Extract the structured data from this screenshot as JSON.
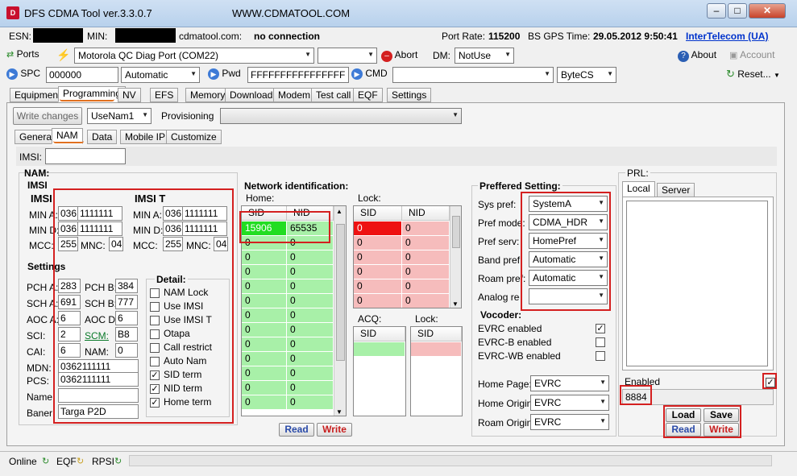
{
  "window": {
    "title": "DFS CDMA Tool ver.3.3.0.7",
    "site": "WWW.CDMATOOL.COM",
    "icon_letter": "D"
  },
  "infobar": {
    "esn_label": "ESN:",
    "min_label": "MIN:",
    "site_label": "cdmatool.com:",
    "connection_status": "no connection",
    "port_rate_label": "Port Rate:",
    "port_rate_value": "115200",
    "bs_gps_label": "BS GPS Time:",
    "bs_gps_value": "29.05.2012 9:50:41",
    "operator_link": "InterTelecom (UA)"
  },
  "toolbar1": {
    "ports_label": "Ports",
    "port_select": "Motorola QC Diag Port (COM22)",
    "abort_label": "Abort",
    "dm_label": "DM:",
    "dm_select": "NotUse",
    "about_label": "About",
    "account_label": "Account"
  },
  "toolbar2": {
    "spc_label": "SPC",
    "spc_value": "000000",
    "spc_mode": "Automatic",
    "pwd_label": "Pwd",
    "pwd_value": "FFFFFFFFFFFFFFFF",
    "cmd_label": "CMD",
    "cmd_value": "",
    "bytecs_select": "ByteCS",
    "reset_label": "Reset..."
  },
  "main_tabs": [
    "Equipment",
    "Programming",
    "NV",
    "EFS",
    "Memory",
    "Download",
    "Modem",
    "Test call",
    "EQF",
    "Settings"
  ],
  "programming": {
    "write_changes": "Write changes",
    "nam_select": "UseNam1",
    "provisioning_label": "Provisioning",
    "provisioning_value": ""
  },
  "sub_tabs": [
    "General",
    "NAM",
    "Data",
    "Mobile IP",
    "Customize"
  ],
  "imsi_label": "IMSI:",
  "imsi_value": "",
  "nam": {
    "section_label": "NAM:",
    "imsi_group_label": "IMSI",
    "imsi": {
      "label": "IMSI",
      "min_a_label": "MIN A:",
      "min_a_1": "036",
      "min_a_2": "1111111",
      "min_d_label": "MIN D:",
      "min_d_1": "036",
      "min_d_2": "1111111",
      "mcc_label": "MCC:",
      "mcc_value": "255",
      "mnc_label": "MNC:",
      "mnc_value": "04"
    },
    "imsi_t": {
      "label": "IMSI T",
      "min_a_label": "MIN A:",
      "min_a_1": "036",
      "min_a_2": "1111111",
      "min_d_label": "MIN D:",
      "min_d_1": "036",
      "min_d_2": "1111111",
      "mcc_label": "MCC:",
      "mcc_value": "255",
      "mnc_label": "MNC:",
      "mnc_value": "04"
    },
    "settings": {
      "label": "Settings",
      "pch_a_label": "PCH A:",
      "pch_a": "283",
      "pch_b_label": "PCH B:",
      "pch_b": "384",
      "sch_a_label": "SCH A:",
      "sch_a": "691",
      "sch_b_label": "SCH B:",
      "sch_b": "777",
      "aoc_a_label": "AOC A:",
      "aoc_a": "6",
      "aoc_d_label": "AOC D:",
      "aoc_d": "6",
      "sci_label": "SCI:",
      "sci": "2",
      "scm_label": "SCM:",
      "scm": "B8",
      "cai_label": "CAI:",
      "cai": "6",
      "nam_label": "NAM:",
      "nam": "0",
      "mdn_label": "MDN:",
      "mdn": "0362111111",
      "pcs_label": "PCS:",
      "pcs": "0362111111",
      "name_label": "Name:",
      "name": "",
      "baner_label": "Baner:",
      "baner": "Targa P2D"
    },
    "detail": {
      "label": "Detail:",
      "items": [
        {
          "label": "NAM Lock",
          "checked": false
        },
        {
          "label": "Use IMSI",
          "checked": false
        },
        {
          "label": "Use IMSI T",
          "checked": false
        },
        {
          "label": "Otapa",
          "checked": false
        },
        {
          "label": "Call restrict",
          "checked": false
        },
        {
          "label": "Auto Nam",
          "checked": false
        },
        {
          "label": "SID term",
          "checked": true
        },
        {
          "label": "NID term",
          "checked": true
        },
        {
          "label": "Home term",
          "checked": true
        }
      ]
    }
  },
  "network": {
    "label": "Network identification:",
    "home_label": "Home:",
    "home_sid_header": "SID",
    "home_nid_header": "NID",
    "home_rows": [
      [
        "15906",
        "65535"
      ],
      [
        "0",
        "0"
      ],
      [
        "0",
        "0"
      ],
      [
        "0",
        "0"
      ],
      [
        "0",
        "0"
      ],
      [
        "0",
        "0"
      ],
      [
        "0",
        "0"
      ],
      [
        "0",
        "0"
      ],
      [
        "0",
        "0"
      ],
      [
        "0",
        "0"
      ],
      [
        "0",
        "0"
      ],
      [
        "0",
        "0"
      ],
      [
        "0",
        "0"
      ]
    ],
    "lock_label": "Lock:",
    "lock_sid_header": "SID",
    "lock_nid_header": "NID",
    "lock_rows": [
      [
        "0",
        "0"
      ],
      [
        "0",
        "0"
      ],
      [
        "0",
        "0"
      ],
      [
        "0",
        "0"
      ],
      [
        "0",
        "0"
      ],
      [
        "0",
        "0"
      ]
    ],
    "acq_label": "ACQ:",
    "acq_header": "SID",
    "lock2_label": "Lock:",
    "lock2_header": "SID",
    "read_label": "Read",
    "write_label": "Write",
    "green_color": "#a8f0a8",
    "pink_color": "#f6bcbc"
  },
  "preferred": {
    "label": "Preffered Setting:",
    "sys_pref_label": "Sys pref:",
    "sys_pref": "SystemA",
    "pref_mode_label": "Pref mode:",
    "pref_mode": "CDMA_HDR",
    "pref_serv_label": "Pref serv:",
    "pref_serv": "HomePref",
    "band_pref_label": "Band pref:",
    "band_pref": "Automatic",
    "roam_pref_label": "Roam pref:",
    "roam_pref": "Automatic",
    "analog_reg_label": "Analog reg:",
    "analog_reg": ""
  },
  "vocoder": {
    "label": "Vocoder:",
    "items": [
      {
        "label": "EVRC enabled",
        "checked": true
      },
      {
        "label": "EVRC-B enabled",
        "checked": false
      },
      {
        "label": "EVRC-WB enabled",
        "checked": false
      }
    ],
    "home_page_label": "Home Page:",
    "home_page": "EVRC",
    "home_origin_label": "Home Origin:",
    "home_origin": "EVRC",
    "roam_origin_label": "Roam Origin:",
    "roam_origin": "EVRC"
  },
  "prl": {
    "label": "PRL:",
    "tabs": [
      "Local",
      "Server"
    ],
    "enabled_label": "Enabled",
    "enabled": true,
    "prl_value": "8884",
    "load_label": "Load",
    "save_label": "Save",
    "read_label": "Read",
    "write_label": "Write"
  },
  "statusbar": {
    "online_label": "Online",
    "eqf_label": "EQF",
    "rpsi_label": "RPSI"
  }
}
